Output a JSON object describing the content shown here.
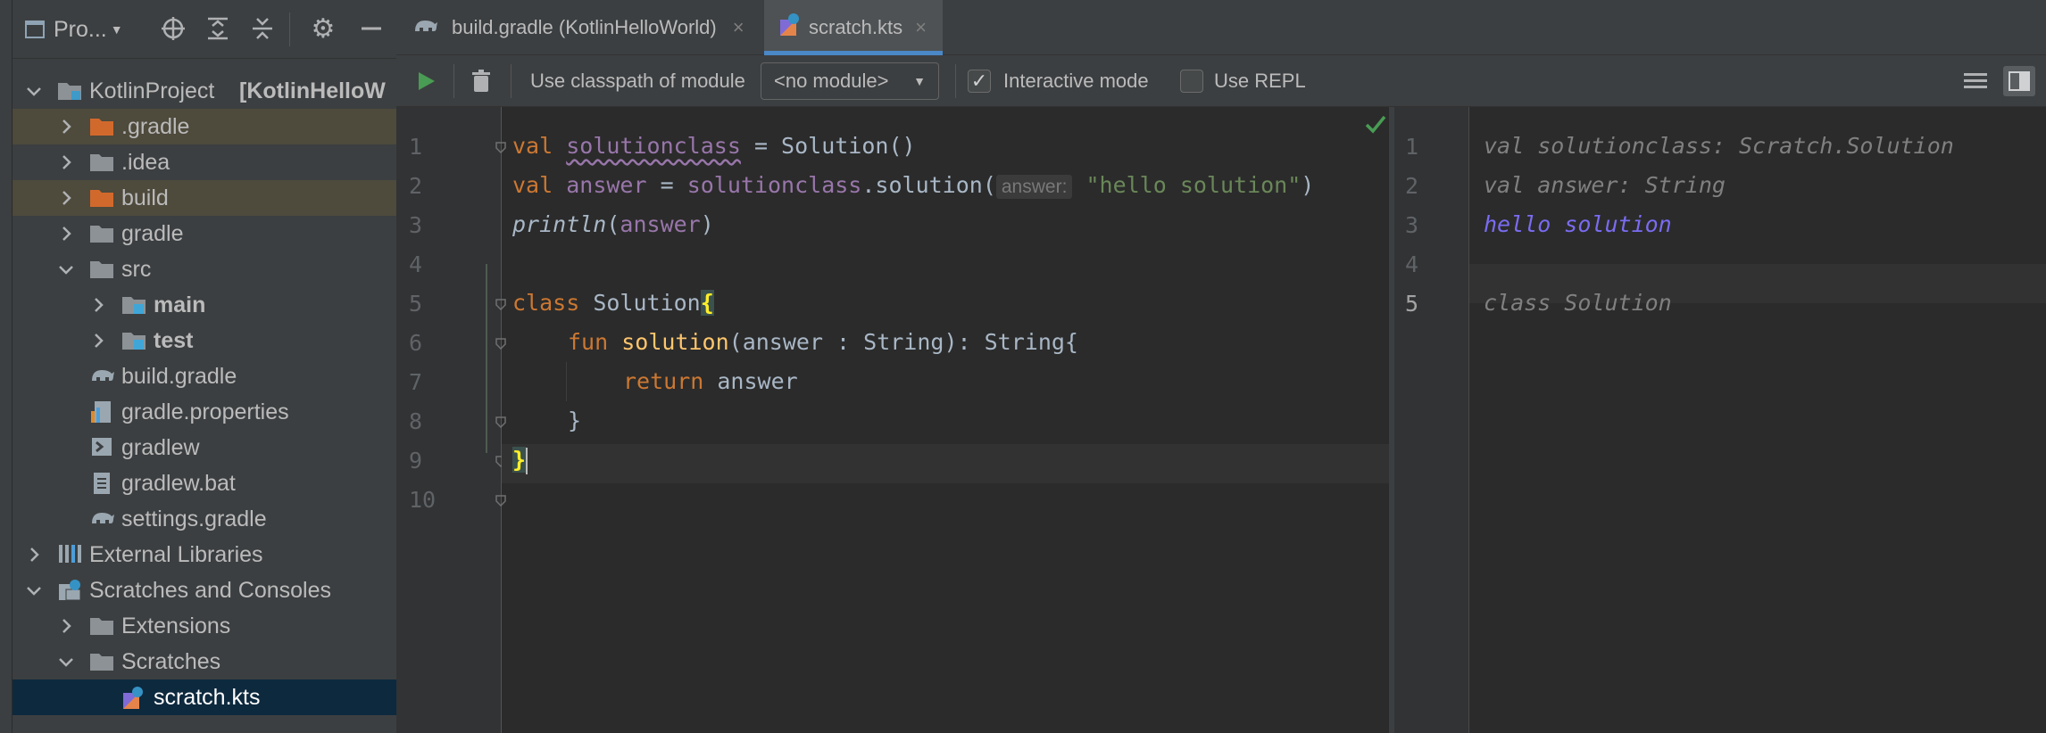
{
  "project_panel": {
    "title": "Pro...",
    "tree": [
      {
        "label": "KotlinProject",
        "suffix": "[KotlinHelloW",
        "level": 0,
        "icon": "module-folder-icon",
        "expanded": true
      },
      {
        "label": ".gradle",
        "level": 1,
        "icon": "folder-excluded-icon",
        "expanded": false,
        "highlight": true
      },
      {
        "label": ".idea",
        "level": 1,
        "icon": "folder-icon",
        "expanded": false
      },
      {
        "label": "build",
        "level": 1,
        "icon": "folder-excluded-icon",
        "expanded": false,
        "highlight": true
      },
      {
        "label": "gradle",
        "level": 1,
        "icon": "folder-icon",
        "expanded": false
      },
      {
        "label": "src",
        "level": 1,
        "icon": "folder-icon",
        "expanded": true
      },
      {
        "label": "main",
        "level": 2,
        "icon": "source-folder-icon",
        "expanded": false,
        "bold": true
      },
      {
        "label": "test",
        "level": 2,
        "icon": "source-folder-icon",
        "expanded": false,
        "bold": true
      },
      {
        "label": "build.gradle",
        "level": 1,
        "icon": "gradle-elephant-icon"
      },
      {
        "label": "gradle.properties",
        "level": 1,
        "icon": "properties-file-icon"
      },
      {
        "label": "gradlew",
        "level": 1,
        "icon": "shell-script-icon"
      },
      {
        "label": "gradlew.bat",
        "level": 1,
        "icon": "text-file-icon"
      },
      {
        "label": "settings.gradle",
        "level": 1,
        "icon": "gradle-elephant-icon"
      },
      {
        "label": "External Libraries",
        "level": 0,
        "icon": "libraries-icon",
        "expanded": false
      },
      {
        "label": "Scratches and Consoles",
        "level": 0,
        "icon": "scratches-icon",
        "expanded": true
      },
      {
        "label": "Extensions",
        "level": 1,
        "icon": "folder-icon",
        "expanded": false
      },
      {
        "label": "Scratches",
        "level": 1,
        "icon": "folder-icon",
        "expanded": true
      },
      {
        "label": "scratch.kts",
        "level": 2,
        "icon": "kotlin-scratch-icon",
        "selected": true
      }
    ]
  },
  "tabs": [
    {
      "label": "build.gradle (KotlinHelloWorld)",
      "close": "×",
      "active": false
    },
    {
      "label": "scratch.kts",
      "close": "×",
      "active": true
    }
  ],
  "scratch_toolbar": {
    "classpath_label": "Use classpath of module",
    "module_value": "<no module>",
    "interactive_label": "Interactive mode",
    "interactive_checked": true,
    "repl_label": "Use REPL",
    "repl_checked": false
  },
  "editor": {
    "line_numbers": [
      "1",
      "2",
      "3",
      "4",
      "5",
      "6",
      "7",
      "8",
      "9",
      "10"
    ],
    "param_hint": "answer:",
    "tokens": {
      "val": "val",
      "solutionclass": "solutionclass",
      "eq_solution_call": " = Solution()",
      "answer": "answer",
      "eq": " = ",
      "dot_solution": ".solution(",
      "hello_string": "\"hello solution\"",
      "close_paren": ")",
      "println": "println",
      "open_paren": "(",
      "class_kw": "class",
      "class_name": " Solution",
      "open_brace": "{",
      "fun_kw": "fun",
      "solution_fn": "solution",
      "sig_rest": "(answer : String): String{",
      "return_kw": "return",
      "return_rest": " answer",
      "close_brace": "}"
    }
  },
  "output": {
    "line_numbers": [
      "1",
      "2",
      "3",
      "4",
      "5"
    ],
    "lines": [
      "val solutionclass: Scratch.Solution",
      "val answer: String",
      "hello solution",
      "",
      "class Solution"
    ]
  },
  "colors": {
    "background": "#2b2b2b",
    "panel": "#3c3f41",
    "keyword": "#cc7832",
    "property": "#9876aa",
    "function": "#ffc66d",
    "string": "#6a8759",
    "result": "#7a6cf2",
    "active_tab_underline": "#4a88c7"
  }
}
